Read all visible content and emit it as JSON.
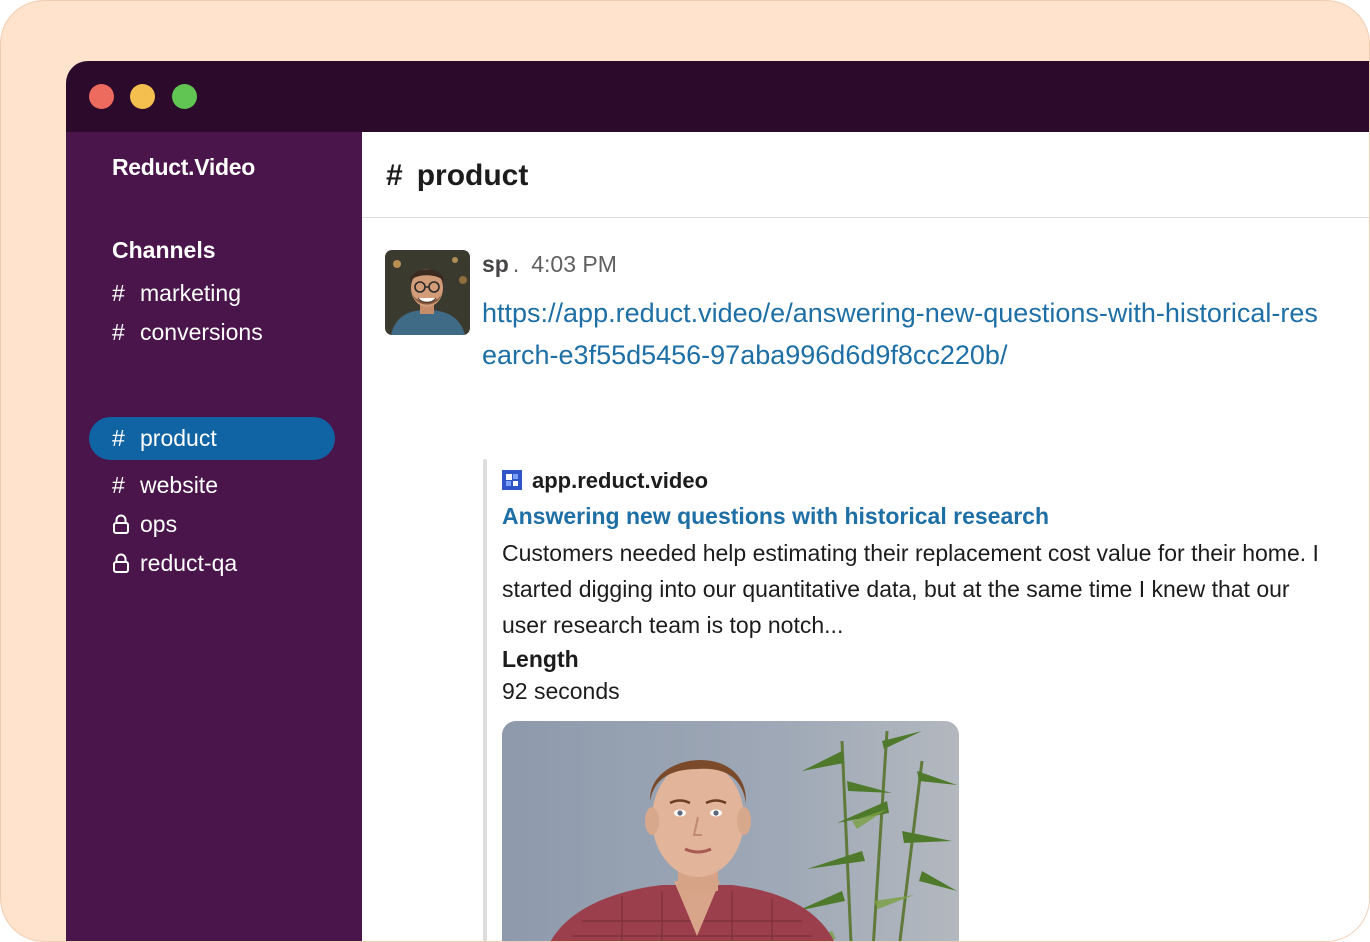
{
  "window": {
    "controls": [
      "close",
      "minimize",
      "maximize"
    ]
  },
  "sidebar": {
    "workspace": "Reduct.Video",
    "channels_heading": "Channels",
    "channels": [
      {
        "prefix": "#",
        "name": "marketing",
        "private": false,
        "active": false
      },
      {
        "prefix": "#",
        "name": "conversions",
        "private": false,
        "active": false
      },
      {
        "prefix": "#",
        "name": "product",
        "private": false,
        "active": true
      },
      {
        "prefix": "#",
        "name": "website",
        "private": false,
        "active": false
      },
      {
        "prefix": "lock-icon",
        "name": "ops",
        "private": true,
        "active": false
      },
      {
        "prefix": "lock-icon",
        "name": "reduct-qa",
        "private": true,
        "active": false
      }
    ]
  },
  "header": {
    "hash": "#",
    "channel_name": "product"
  },
  "message": {
    "author": "sp",
    "separator": ".",
    "time": "4:03 PM",
    "link": "https://app.reduct.video/e/answering-new-questions-with-historical-research-e3f55d5456-97aba996d6d9f8cc220b/"
  },
  "unfurl": {
    "site_icon": "reduct-logo-icon",
    "site": "app.reduct.video",
    "title": "Answering new questions with historical research",
    "description": "Customers needed help estimating their replacement cost value for their home. I started digging into our quantitative data, but at the same time I knew that our user research team is top notch...",
    "field_label": "Length",
    "field_value": "92 seconds"
  },
  "colors": {
    "frame": "#ffe3cc",
    "titlebar": "#2c0a2c",
    "sidebar": "#4a154b",
    "active_channel": "#1164a3",
    "link": "#1d6fa5"
  }
}
